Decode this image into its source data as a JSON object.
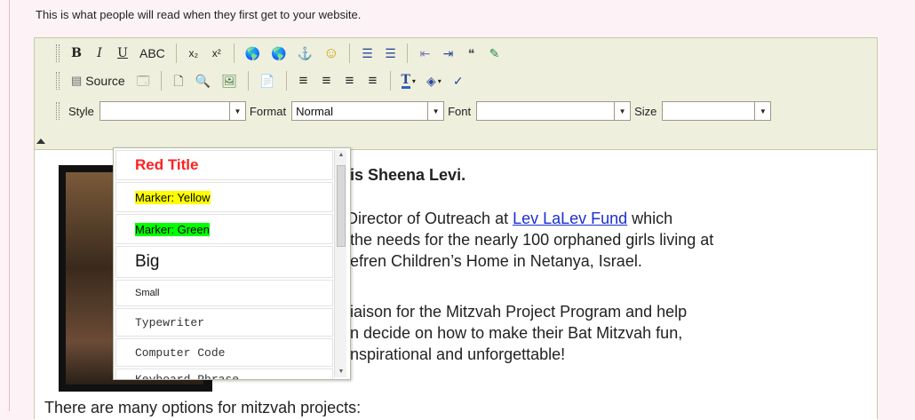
{
  "intro_text": "This is what people will read when they first get to your website.",
  "toolbar": {
    "row1": {
      "bold": "B",
      "italic": "I",
      "underline": "U",
      "strike": "ABC",
      "subscript": "x₂",
      "superscript": "x²",
      "link_icon": "🌎",
      "unlink_icon": "🌎",
      "anchor_icon": "⚓",
      "smiley_icon": "☺",
      "numbered_list_icon": "☰",
      "bulleted_list_icon": "☰",
      "outdent_icon": "⇤",
      "indent_icon": "⇥",
      "blockquote_icon": "❝",
      "div_icon": "✎"
    },
    "row2": {
      "source_label": "Source",
      "source_icon": "▤",
      "preview_icon": "🗔",
      "newpage_icon": "🗋",
      "find_icon": "🔍",
      "image_icon": "🖼",
      "pastetext_icon": "📄",
      "align_left_icon": "≡",
      "align_center_icon": "≡",
      "align_right_icon": "≡",
      "justify_icon": "≡",
      "textcolor_icon": "T",
      "bgcolor_icon": "◈",
      "spellcheck_icon": "✓"
    },
    "row3": {
      "style_label": "Style",
      "style_value": "",
      "format_label": "Format",
      "format_value": "Normal",
      "font_label": "Font",
      "font_value": "",
      "size_label": "Size",
      "size_value": ""
    }
  },
  "style_dropdown": {
    "items": [
      {
        "label": "Red Title",
        "color": "#ff2020",
        "bg": "#ffffff"
      },
      {
        "label": "Marker: Yellow",
        "color": "#000000",
        "bg": "#ffff00"
      },
      {
        "label": "Marker: Green",
        "color": "#000000",
        "bg": "#00ff00"
      },
      {
        "label": "Big",
        "color": "#000000",
        "bg": "#ffffff"
      },
      {
        "label": "Small",
        "color": "#000000",
        "bg": "#ffffff"
      },
      {
        "label": "Typewriter",
        "color": "#333333",
        "bg": "#ffffff"
      },
      {
        "label": "Computer Code",
        "color": "#333333",
        "bg": "#ffffff"
      },
      {
        "label": "Keyboard Phrase",
        "color": "#333333",
        "bg": "#ffffff"
      }
    ]
  },
  "content": {
    "line1": "e is Sheena Levi.",
    "line2_pre": " Director of Outreach at ",
    "line2_link": "Lev LaLev Fund",
    "line2_post": " which",
    "line3": "the needs for the nearly 100 orphaned girls living at",
    "line4": "efren Children’s  Home in Netanya, Israel.",
    "line5": " liaison for the Mitzvah Project Program and help",
    "line6": "n decide on how to make their Bat Mitzvah fun,",
    "line7": " inspirational and unforgettable!"
  },
  "below_text": "There are many options for mitzvah projects:",
  "colors": {
    "link": "#1a2fd0",
    "toolbar_bg": "#efefde"
  }
}
